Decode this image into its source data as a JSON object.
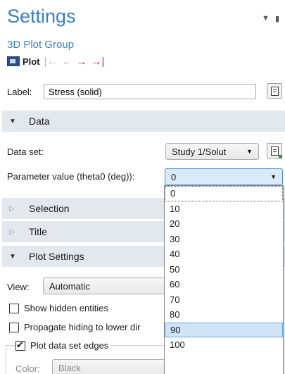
{
  "header": {
    "title": "Settings",
    "subtitle": "3D Plot Group",
    "pin_icon": "pin-icon",
    "menu_icon": "chevron-down-icon"
  },
  "toolbar": {
    "plot_label": "Plot",
    "buttons": [
      "first-icon",
      "previous-icon",
      "next-icon",
      "last-icon"
    ]
  },
  "label_row": {
    "label": "Label:",
    "value": "Stress (solid)"
  },
  "sections": {
    "data": "Data",
    "selection": "Selection",
    "title": "Title",
    "plot_settings": "Plot Settings"
  },
  "data": {
    "dataset_label": "Data set:",
    "dataset_value": "Study 1/Solut",
    "param_label": "Parameter value (theta0 (deg)):",
    "param_value": "0",
    "options": [
      "0",
      "10",
      "20",
      "30",
      "40",
      "50",
      "60",
      "70",
      "80",
      "90",
      "100"
    ],
    "selected_option": "90"
  },
  "plot_settings": {
    "view_label": "View:",
    "view_value": "Automatic",
    "show_hidden": "Show hidden entities",
    "propagate": "Propagate hiding to lower dir",
    "plot_edges": "Plot data set edges",
    "color_label": "Color:",
    "color_value": "Black"
  },
  "colors": {
    "accent": "#3a7fc1",
    "section_bg": "#e3e8ef",
    "selection": "#cfe4f7",
    "nav_active": "#b4207c"
  }
}
